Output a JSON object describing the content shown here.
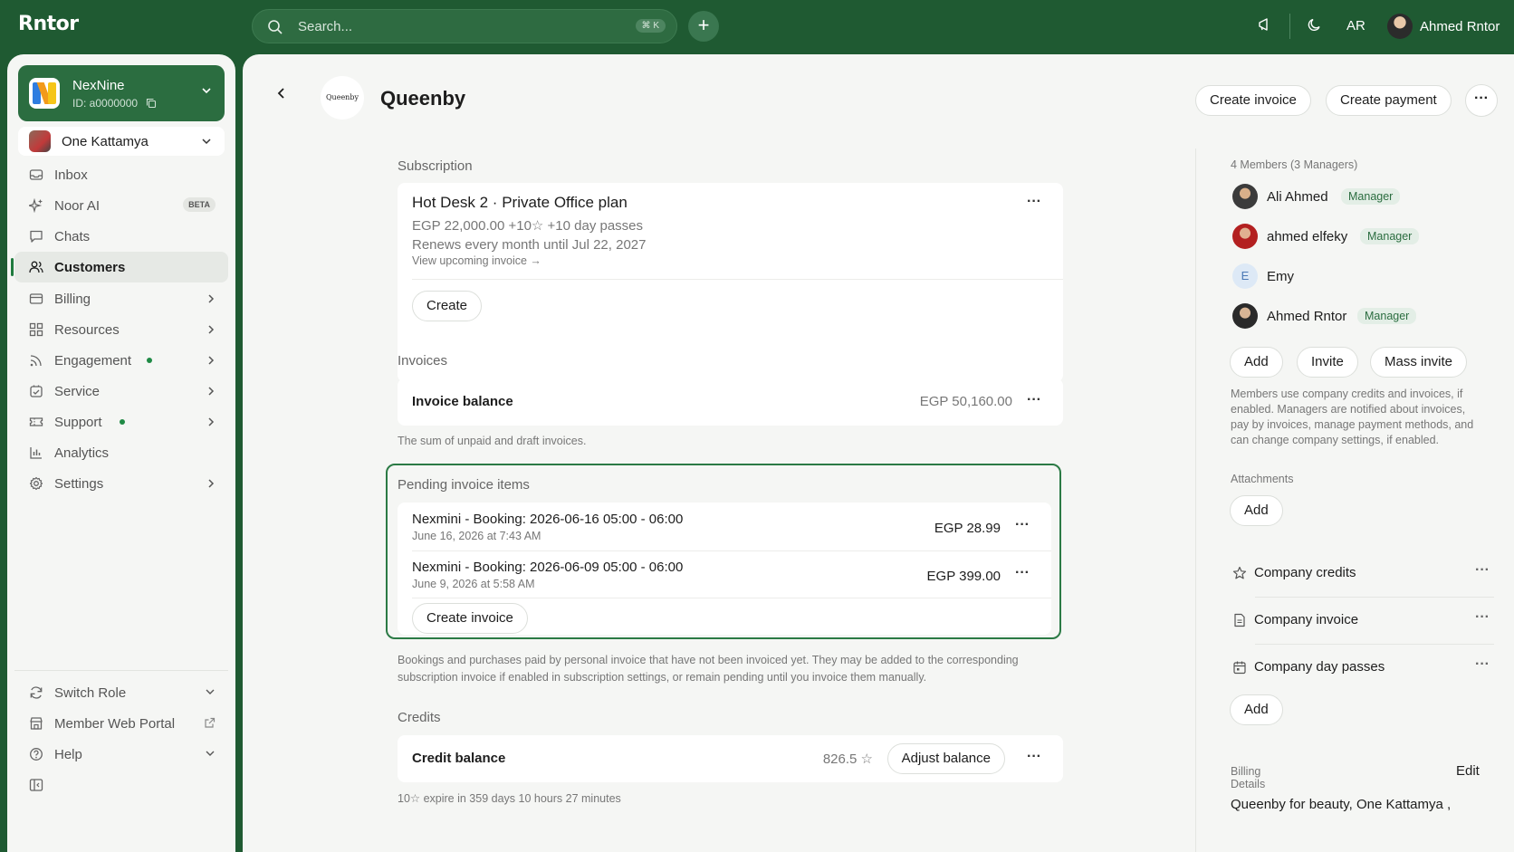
{
  "topbar": {
    "brand": "Rntor",
    "search_placeholder": "Search...",
    "search_shortcut": "⌘ K",
    "new_label": "+",
    "language": "AR",
    "user_name": "Ahmed Rntor"
  },
  "sidebar": {
    "workspace": {
      "name": "NexNine",
      "id": "ID: a0000000"
    },
    "location": "One Kattamya",
    "items": [
      {
        "label": "Inbox",
        "icon": "inbox-icon"
      },
      {
        "label": "Noor AI",
        "icon": "sparkle-icon",
        "badge": "BETA"
      },
      {
        "label": "Chats",
        "icon": "chat-icon"
      },
      {
        "label": "Customers",
        "icon": "users-icon",
        "active": true
      },
      {
        "label": "Billing",
        "icon": "billing-icon"
      },
      {
        "label": "Resources",
        "icon": "grid-icon"
      },
      {
        "label": "Engagement",
        "icon": "rss-icon",
        "dot": true
      },
      {
        "label": "Service",
        "icon": "service-icon"
      },
      {
        "label": "Support",
        "icon": "ticket-icon",
        "dot": true
      },
      {
        "label": "Analytics",
        "icon": "chart-icon"
      },
      {
        "label": "Settings",
        "icon": "gear-icon"
      }
    ],
    "bottom": [
      {
        "label": "Switch Role"
      },
      {
        "label": "Member Web Portal"
      },
      {
        "label": "Help"
      }
    ]
  },
  "customer": {
    "logo_text": "Queenby",
    "name": "Queenby",
    "actions": {
      "create_invoice": "Create invoice",
      "create_payment": "Create payment"
    }
  },
  "subscription": {
    "section_label": "Subscription",
    "plan": "Hot Desk 2 · Private Office plan",
    "price_line": "EGP 22,000.00 +10☆ +10 day passes",
    "renew_line": "Renews every month until Jul 22, 2027",
    "upcoming_link": "View upcoming invoice →",
    "create_label": "Create"
  },
  "invoices": {
    "section_label": "Invoices",
    "balance_label": "Invoice balance",
    "balance_value": "EGP 50,160.00",
    "hint": "The sum of unpaid and draft invoices."
  },
  "pending": {
    "section_label": "Pending invoice items",
    "items": [
      {
        "title": "Nexmini - Booking: 2026-06-16 05:00 - 06:00",
        "date": "June 16, 2026 at 7:43 AM",
        "amount": "EGP 28.99"
      },
      {
        "title": "Nexmini - Booking: 2026-06-09 05:00 - 06:00",
        "date": "June 9, 2026 at 5:58 AM",
        "amount": "EGP 399.00"
      }
    ],
    "create_label": "Create invoice",
    "hint_line1": "Bookings and purchases paid by personal invoice that have not been invoiced yet. They may be added to the corresponding",
    "hint_line2": "subscription invoice if enabled in subscription settings, or remain pending until you invoice them manually."
  },
  "credits": {
    "section_label": "Credits",
    "balance_label": "Credit balance",
    "balance_value": "826.5 ☆",
    "adjust_label": "Adjust balance",
    "hint": "10☆ expire in 359 days 10 hours 27 minutes"
  },
  "members": {
    "summary": "4 Members (3 Managers)",
    "list": [
      {
        "name": "Ali Ahmed",
        "role": "Manager",
        "avatar": "photo"
      },
      {
        "name": "ahmed elfeky",
        "role": "Manager",
        "avatar": "photo"
      },
      {
        "name": "Emy",
        "role": "",
        "avatar": "E"
      },
      {
        "name": "Ahmed Rntor",
        "role": "Manager",
        "avatar": "photo"
      }
    ],
    "add_label": "Add",
    "invite_label": "Invite",
    "mass_invite_label": "Mass invite",
    "hint_lines": [
      "Members use company credits and invoices, if",
      "enabled. Managers are notified about invoices,",
      "pay by invoices, manage payment methods, and",
      "can change company settings, if enabled."
    ]
  },
  "attachments": {
    "label": "Attachments",
    "add_label": "Add"
  },
  "company_features": [
    {
      "label": "Company credits",
      "icon": "star-icon"
    },
    {
      "label": "Company invoice",
      "icon": "document-icon"
    },
    {
      "label": "Company day passes",
      "icon": "calendar-icon"
    }
  ],
  "company_add_label": "Add",
  "billing_details": {
    "label": "Billing Details",
    "edit_label": "Edit",
    "value": "Queenby for beauty, One Kattamya ,"
  },
  "colors": {
    "brand_green": "#1f5a32",
    "accent": "#2b7a45",
    "surface": "#f5f6f4"
  }
}
